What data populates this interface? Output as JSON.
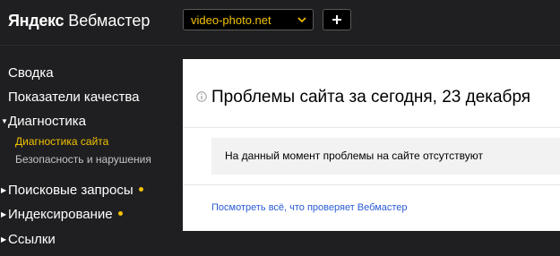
{
  "header": {
    "brand_strong": "Яндекс",
    "brand_rest": "Вебмастер",
    "site_select": {
      "value": "video-photo.net",
      "icon": "chevron-down-icon"
    },
    "add_button": {
      "icon": "plus-icon"
    }
  },
  "sidebar": {
    "items": [
      {
        "label": "Сводка"
      },
      {
        "label": "Показатели качества"
      },
      {
        "label": "Диагностика",
        "expanded": true,
        "children": [
          {
            "label": "Диагностика сайта",
            "active": true
          },
          {
            "label": "Безопасность и нарушения"
          }
        ]
      },
      {
        "label": "Поисковые запросы",
        "has_dot": true
      },
      {
        "label": "Индексирование",
        "has_dot": true
      },
      {
        "label": "Ссылки"
      }
    ]
  },
  "main": {
    "title": "Проблемы сайта за сегодня, 23 декабря",
    "notice": "На данный момент проблемы на сайте отсутствуют",
    "link": "Посмотреть всё, что проверяет Вебмастер"
  },
  "colors": {
    "background": "#1f1f21",
    "accent": "#f2c200",
    "link": "#2a5bd7",
    "panel": "#ffffff",
    "notice_bg": "#f2f2f2"
  }
}
